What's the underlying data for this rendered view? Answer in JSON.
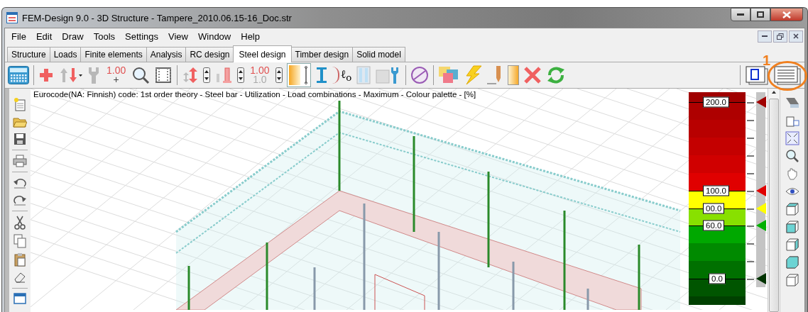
{
  "window": {
    "title": "FEM-Design 9.0 - 3D Structure - Tampere_2010.06.15-16_Doc.str"
  },
  "menu": [
    "File",
    "Edit",
    "Draw",
    "Tools",
    "Settings",
    "View",
    "Window",
    "Help"
  ],
  "tabs": [
    {
      "label": "Structure",
      "selected": false
    },
    {
      "label": "Loads",
      "selected": false
    },
    {
      "label": "Finite elements",
      "selected": false
    },
    {
      "label": "Analysis",
      "selected": false
    },
    {
      "label": "RC design",
      "selected": false
    },
    {
      "label": "Steel design",
      "selected": true
    },
    {
      "label": "Timber design",
      "selected": false
    },
    {
      "label": "Solid model",
      "selected": false
    }
  ],
  "toolbar": {
    "load_factor": [
      "1.00",
      "+"
    ],
    "factor_step": [
      "1.00",
      "1.0"
    ],
    "buckling_length": "ℓ$_{o}$"
  },
  "annotation": {
    "label": "1"
  },
  "view": {
    "caption": "Eurocode(NA: Finnish) code: 1st order theory - Steel bar - Utilization - Load combinations - Maximum - Colour palette - [%]"
  },
  "palette": {
    "markers": [
      {
        "label": "200.0",
        "color": "#a00000"
      },
      {
        "label": "100.0",
        "color": "#e00000"
      },
      {
        "label": "00.0",
        "color": "#ffff00"
      },
      {
        "label": "60.0",
        "color": "#00b000"
      },
      {
        "label": "0.0",
        "color": "#003300"
      }
    ]
  }
}
